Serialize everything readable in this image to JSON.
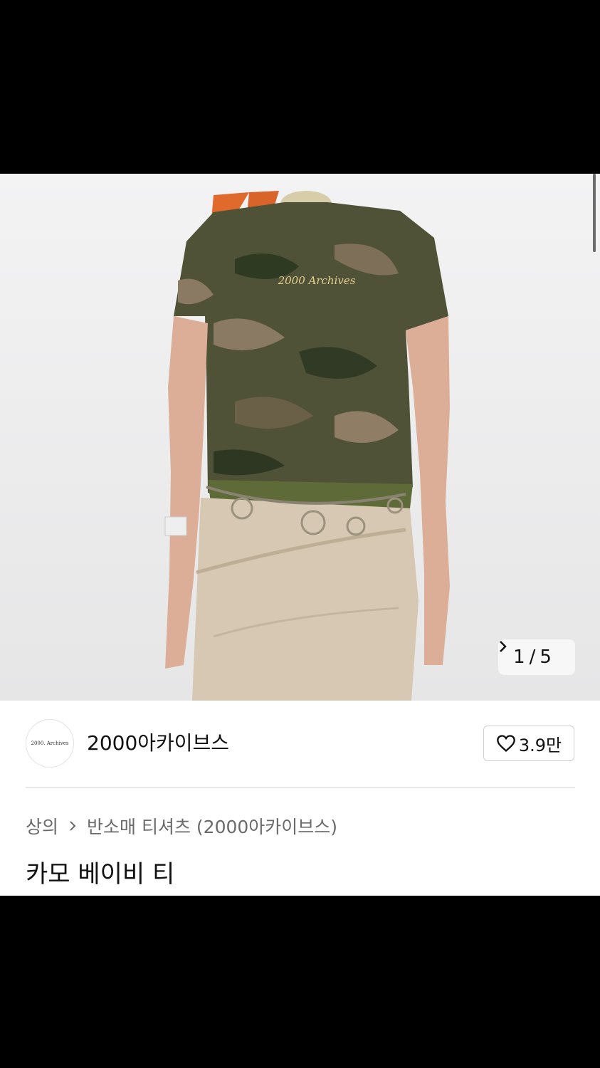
{
  "gallery": {
    "print_text": "2000 Archives",
    "current_page": "1",
    "separator": "/",
    "total_pages": "5",
    "next_icon": "chevron-right-icon"
  },
  "brand": {
    "logo_text": "2000. Archives",
    "name": "2000아카이브스",
    "like_icon": "heart-outline-icon",
    "like_count": "3.9만"
  },
  "breadcrumb": {
    "items": [
      "상의",
      "반소매 티셔츠 (2000아카이브스)"
    ],
    "separator_icon": "chevron-right-icon"
  },
  "product": {
    "title": "카모 베이비 티"
  }
}
